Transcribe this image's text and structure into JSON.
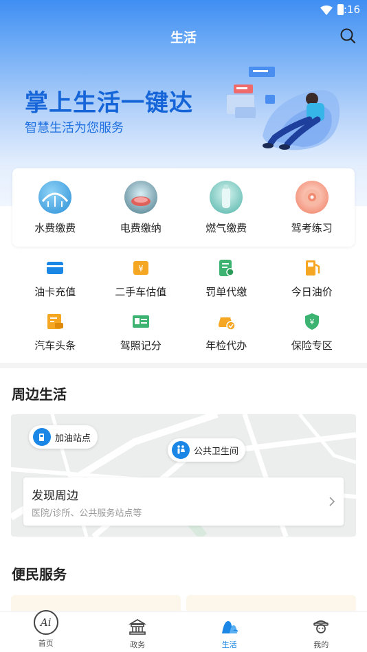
{
  "status_bar": {
    "time": "3:16"
  },
  "header": {
    "title": "生活"
  },
  "banner": {
    "headline": "掌上生活一键达",
    "subtitle": "智慧生活为您服务"
  },
  "featured": [
    {
      "label": "水费缴费",
      "icon": "water-bill-icon"
    },
    {
      "label": "电费缴纳",
      "icon": "electric-bill-icon"
    },
    {
      "label": "燃气缴费",
      "icon": "gas-bill-icon"
    },
    {
      "label": "驾考练习",
      "icon": "driving-test-icon"
    }
  ],
  "grid": [
    {
      "label": "油卡充值",
      "icon": "fuel-card-icon",
      "color": "#1a87e6"
    },
    {
      "label": "二手车估值",
      "icon": "used-car-valuation-icon",
      "color": "#f5a623"
    },
    {
      "label": "罚单代缴",
      "icon": "ticket-payment-icon",
      "color": "#3cb371"
    },
    {
      "label": "今日油价",
      "icon": "oil-price-icon",
      "color": "#f5a623"
    },
    {
      "label": "汽车头条",
      "icon": "car-news-icon",
      "color": "#f5a623"
    },
    {
      "label": "驾照记分",
      "icon": "license-points-icon",
      "color": "#3cb371"
    },
    {
      "label": "年检代办",
      "icon": "annual-inspection-icon",
      "color": "#f5a623"
    },
    {
      "label": "保险专区",
      "icon": "insurance-icon",
      "color": "#3cb371"
    }
  ],
  "nearby": {
    "title": "周边生活",
    "poi_gas": "加油站点",
    "poi_toilet": "公共卫生间",
    "discover_title": "发现周边",
    "discover_desc": "医院/诊所、公共服务站点等"
  },
  "services": {
    "title": "便民服务"
  },
  "tabbar": [
    {
      "label": "首页",
      "icon": "home-logo-icon"
    },
    {
      "label": "政务",
      "icon": "government-icon"
    },
    {
      "label": "生活",
      "icon": "life-icon",
      "active": true
    },
    {
      "label": "我的",
      "icon": "profile-icon"
    }
  ],
  "colors": {
    "accent": "#1a87e6",
    "headline": "#1565d8",
    "green": "#3cb371",
    "orange": "#f5a623"
  }
}
